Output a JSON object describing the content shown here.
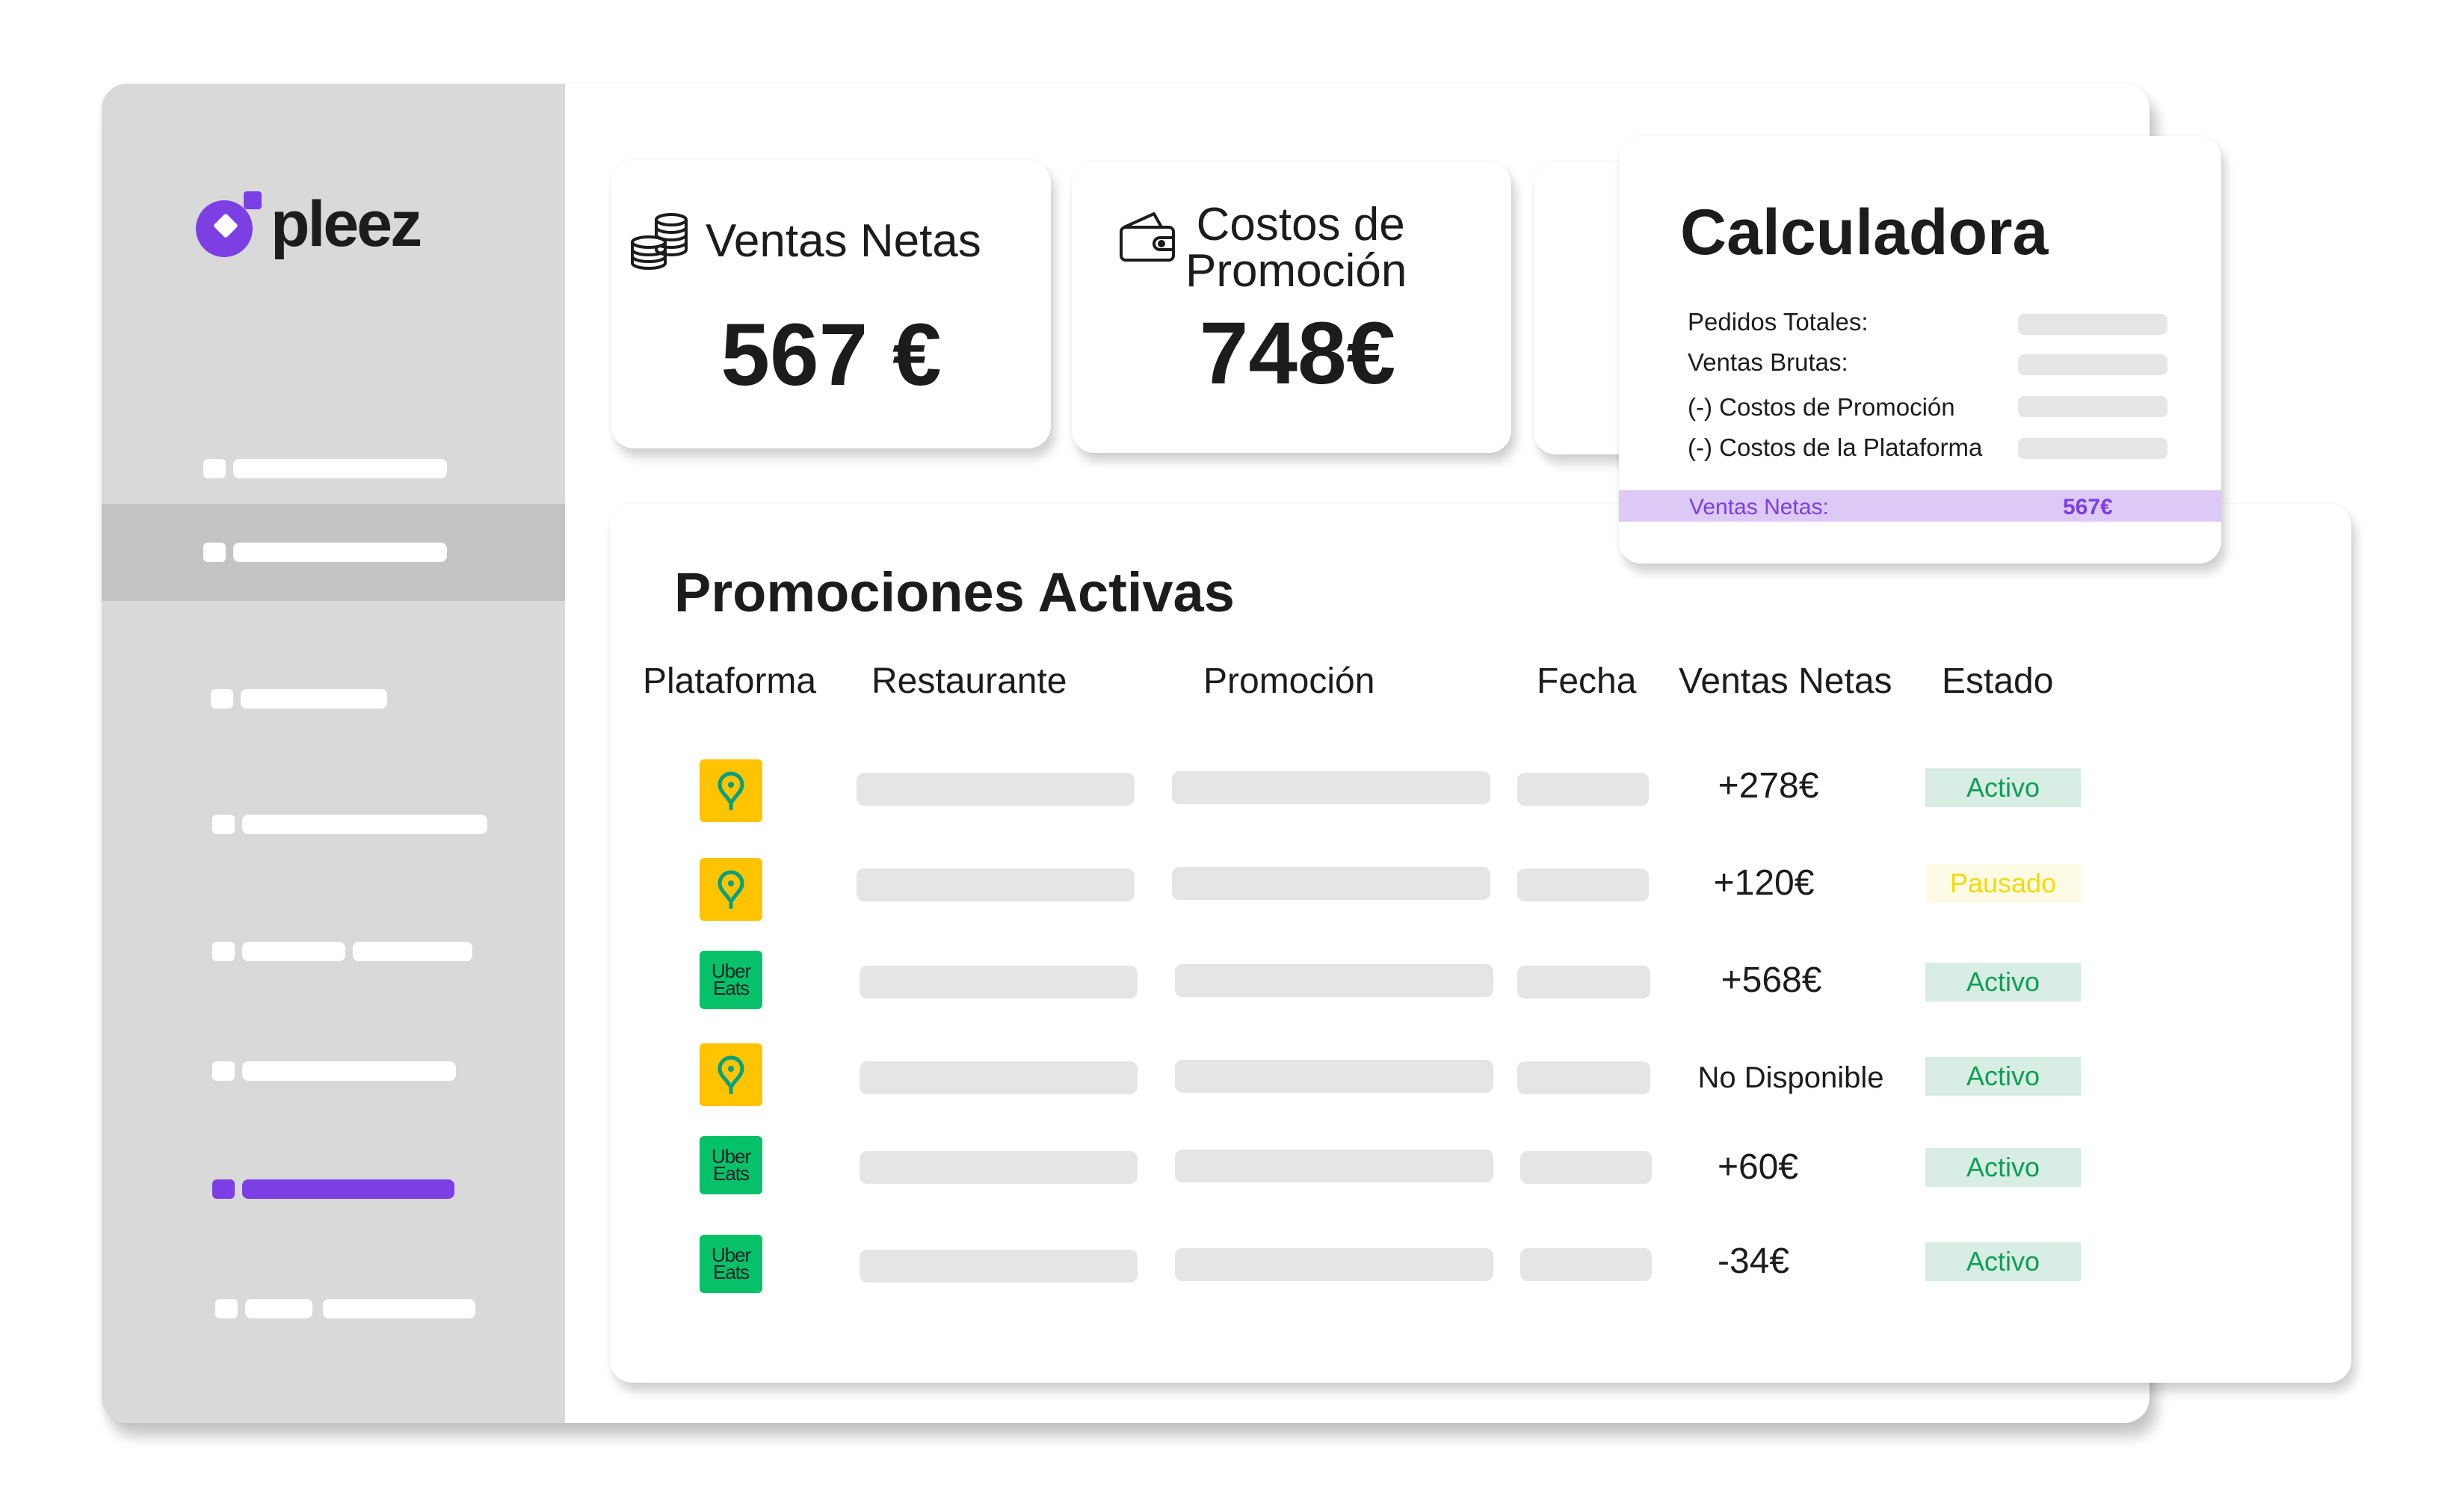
{
  "brand": {
    "name": "pleez",
    "accent_color": "#7b3fe4"
  },
  "sidebar": {
    "active_index": 1,
    "highlight_index": 6,
    "items": [
      "",
      "",
      "",
      "",
      "",
      "",
      "",
      ""
    ]
  },
  "stats": {
    "ventas_netas": {
      "title": "Ventas Netas",
      "value": "567 €",
      "icon": "coins-icon"
    },
    "costos_promocion": {
      "title_line1": "Costos de",
      "title_line2": "Promoción",
      "value": "748€",
      "icon": "wallet-icon"
    }
  },
  "calculator": {
    "title": "Calculadora",
    "rows": [
      {
        "label": "Pedidos Totales:"
      },
      {
        "label": "Ventas Brutas:"
      },
      {
        "label": "(-) Costos de Promoción"
      },
      {
        "label": "(-) Costos de la Plataforma"
      }
    ],
    "total": {
      "label": "Ventas Netas:",
      "value": "567€"
    }
  },
  "promotions": {
    "title": "Promociones Activas",
    "columns": [
      "Plataforma",
      "Restaurante",
      "Promoción",
      "Fecha",
      "Ventas Netas",
      "Estado"
    ],
    "rows": [
      {
        "platform": "glovo",
        "ventas_netas": "+278€",
        "estado": "Activo",
        "estado_type": "activo"
      },
      {
        "platform": "glovo",
        "ventas_netas": "+120€",
        "estado": "Pausado",
        "estado_type": "pausado"
      },
      {
        "platform": "ubereats",
        "platform_label_1": "Uber",
        "platform_label_2": "Eats",
        "ventas_netas": "+568€",
        "estado": "Activo",
        "estado_type": "activo"
      },
      {
        "platform": "glovo",
        "ventas_netas": "No Disponible",
        "estado": "Activo",
        "estado_type": "activo"
      },
      {
        "platform": "ubereats",
        "platform_label_1": "Uber",
        "platform_label_2": "Eats",
        "ventas_netas": "+60€",
        "estado": "Activo",
        "estado_type": "activo"
      },
      {
        "platform": "ubereats",
        "platform_label_1": "Uber",
        "platform_label_2": "Eats",
        "ventas_netas": "-34€",
        "estado": "Activo",
        "estado_type": "activo"
      }
    ]
  }
}
